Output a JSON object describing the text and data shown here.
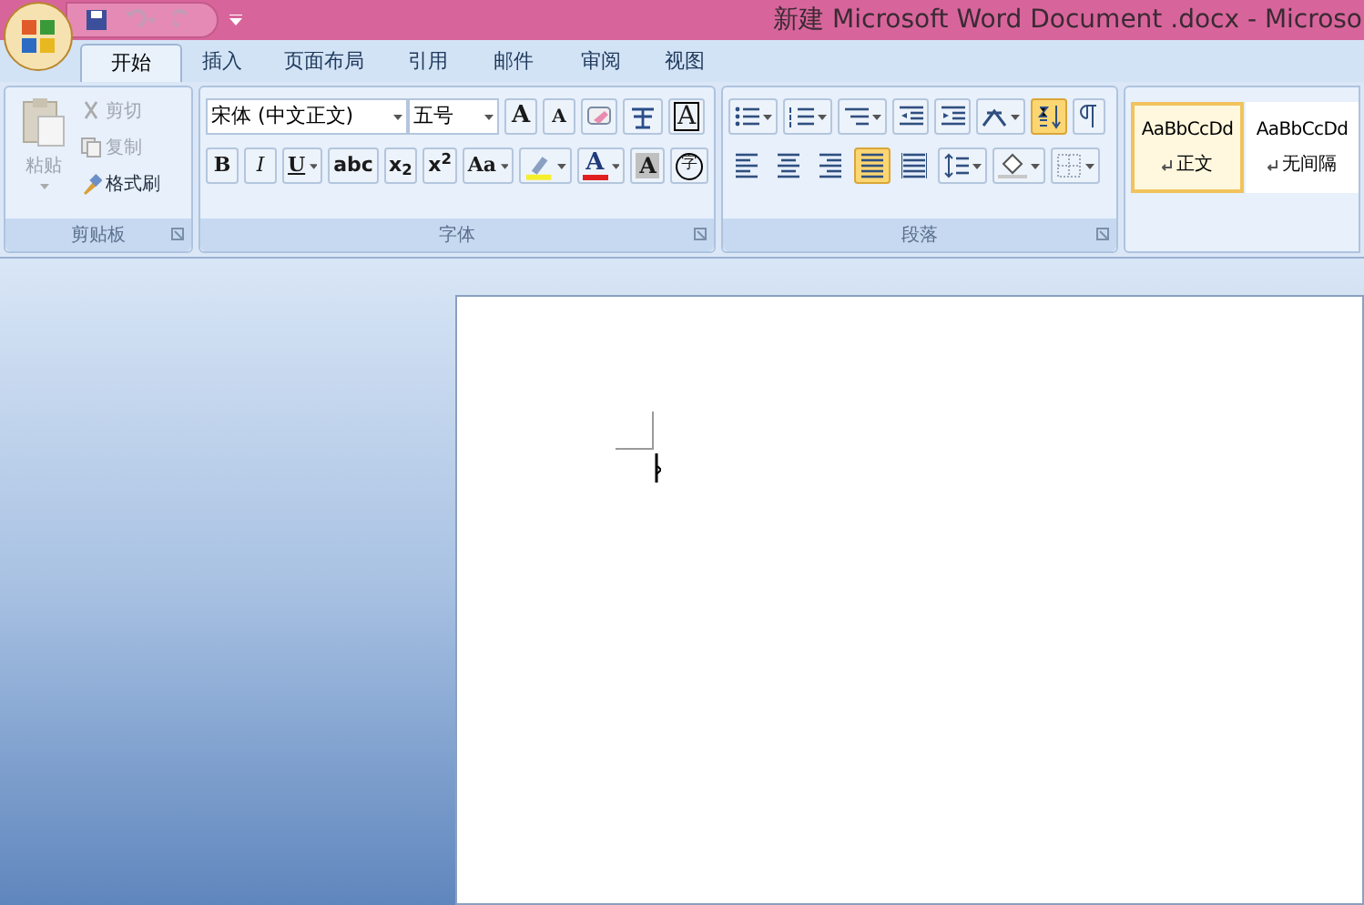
{
  "window": {
    "title": "新建 Microsoft Word Document .docx - Microso"
  },
  "tabs": [
    {
      "label": "开始",
      "selected": true
    },
    {
      "label": "插入",
      "selected": false
    },
    {
      "label": "页面布局",
      "selected": false
    },
    {
      "label": "引用",
      "selected": false
    },
    {
      "label": "邮件",
      "selected": false
    },
    {
      "label": "审阅",
      "selected": false
    },
    {
      "label": "视图",
      "selected": false
    }
  ],
  "clipboard": {
    "paste": "粘贴",
    "cut": "剪切",
    "copy": "复制",
    "format_painter": "格式刷",
    "group_label": "剪贴板"
  },
  "font": {
    "font_name": "宋体 (中文正文)",
    "font_size": "五号",
    "group_label": "字体",
    "row1": [
      {
        "kind": "grow",
        "label": "A"
      },
      {
        "kind": "shrink",
        "label": "A"
      },
      {
        "kind": "clear"
      },
      {
        "kind": "phonetic"
      },
      {
        "kind": "border",
        "label": "A"
      }
    ],
    "row2": [
      {
        "kind": "text",
        "label": "B"
      },
      {
        "kind": "text",
        "label": "I"
      },
      {
        "kind": "split",
        "label": "U"
      },
      {
        "kind": "text",
        "label": "abc"
      },
      {
        "kind": "text",
        "label": "x$_{2}$"
      },
      {
        "kind": "text",
        "label": "x$^{2}$"
      },
      {
        "kind": "split",
        "label": "Aa"
      },
      {
        "kind": "highlight"
      },
      {
        "kind": "color",
        "label": "A"
      },
      {
        "kind": "shade",
        "label": "A"
      },
      {
        "kind": "enclose",
        "label": "字"
      }
    ]
  },
  "paragraph": {
    "group_label": "段落",
    "align": [
      {
        "selected": false
      },
      {
        "selected": false
      },
      {
        "selected": false
      },
      {
        "selected": true
      },
      {
        "selected": false
      }
    ]
  },
  "styles": [
    {
      "preview": "AaBbCcDd",
      "name": "正文",
      "selected": true
    },
    {
      "preview": "AaBbCcDd",
      "name": "无间隔",
      "selected": false
    }
  ]
}
